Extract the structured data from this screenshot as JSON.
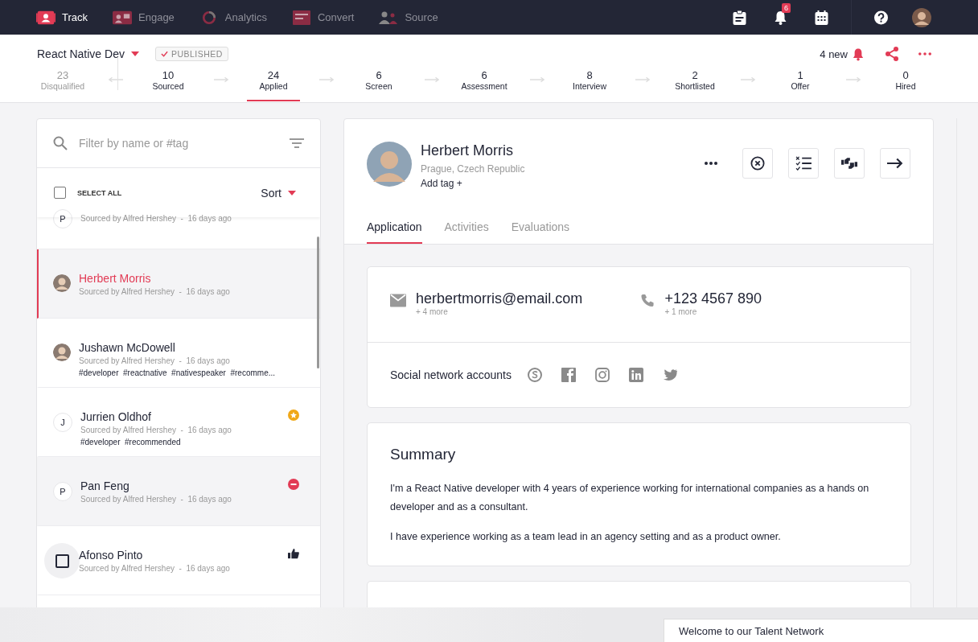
{
  "nav": {
    "items": [
      {
        "label": "Track",
        "selected": true,
        "kind": "track"
      },
      {
        "label": "Engage",
        "selected": false,
        "kind": "engage"
      },
      {
        "label": "Analytics",
        "selected": false,
        "kind": "analytics"
      },
      {
        "label": "Convert",
        "selected": false,
        "kind": "convert"
      },
      {
        "label": "Source",
        "selected": false,
        "kind": "source"
      }
    ],
    "notification_count": "6"
  },
  "job": {
    "title": "React Native Dev",
    "status": "PUBLISHED",
    "new_count": "4 new"
  },
  "stages": [
    {
      "count": "23",
      "label": "Disqualified",
      "selected": false,
      "muted": true
    },
    {
      "count": "10",
      "label": "Sourced",
      "selected": false,
      "muted": false
    },
    {
      "count": "24",
      "label": "Applied",
      "selected": true,
      "muted": false
    },
    {
      "count": "6",
      "label": "Screen",
      "selected": false,
      "muted": false
    },
    {
      "count": "6",
      "label": "Assessment",
      "selected": false,
      "muted": false
    },
    {
      "count": "8",
      "label": "Interview",
      "selected": false,
      "muted": false
    },
    {
      "count": "2",
      "label": "Shortlisted",
      "selected": false,
      "muted": false
    },
    {
      "count": "1",
      "label": "Offer",
      "selected": false,
      "muted": false
    },
    {
      "count": "0",
      "label": "Hired",
      "selected": false,
      "muted": false
    }
  ],
  "list": {
    "search_placeholder": "Filter by name or #tag",
    "select_all": {
      "label": "SELECT ALL",
      "checked": false
    },
    "sort": "Sort",
    "candidates": [
      {
        "avatar": {
          "kind": "initial",
          "initial": "P"
        },
        "source": "Sourced by Alfred Hershey  -  16 days ago",
        "selected": false
      },
      {
        "name": "Herbert Morris",
        "avatar": {
          "kind": "photo"
        },
        "source": "Sourced by Alfred Hershey  -  16 days ago",
        "selected": true
      },
      {
        "name": "Jushawn McDowell",
        "avatar": {
          "kind": "photo"
        },
        "source": "Sourced by Alfred Hershey  -  16 days ago",
        "tags": "#developer  #reactnative  #nativespeaker  #recomme...",
        "selected": false
      },
      {
        "name": "Jurrien Oldhof",
        "avatar": {
          "kind": "initial",
          "initial": "J"
        },
        "source": "Sourced by Alfred Hershey  -  16 days ago",
        "tags": "#developer  #recommended",
        "badge": {
          "kind": "star"
        },
        "selected": false
      },
      {
        "name": "Pan Feng",
        "avatar": {
          "kind": "initial",
          "initial": "P"
        },
        "source": "Sourced by Alfred Hershey  -  16 days ago",
        "badge": {
          "kind": "rejected"
        },
        "selected": false
      },
      {
        "name": "Afonso Pinto",
        "avatar": {
          "kind": "checkbox",
          "checked": false
        },
        "source": "Sourced by Alfred Hershey  -  16 days ago",
        "badge": {
          "kind": "thumbs_up"
        },
        "selected": false
      }
    ]
  },
  "profile": {
    "name": "Herbert Morris",
    "location": "Prague, Czech Republic",
    "add_tag": "Add tag +",
    "tabs": [
      {
        "label": "Application",
        "selected": true
      },
      {
        "label": "Activities",
        "selected": false
      },
      {
        "label": "Evaluations",
        "selected": false
      }
    ],
    "email": "herbertmorris@email.com",
    "email_more": "+ 4 more",
    "phone": "+123 4567 890",
    "phone_more": "+ 1 more",
    "social_label": "Social network accounts",
    "summary_title": "Summary",
    "summary": [
      "I'm a React Native developer with 4 years of experience working for international companies as a hands on developer and as a consultant.",
      "I have experience working as a team lead in an agency setting and as a product owner."
    ]
  },
  "footer_panel": {
    "text": "Welcome to our Talent Network"
  }
}
